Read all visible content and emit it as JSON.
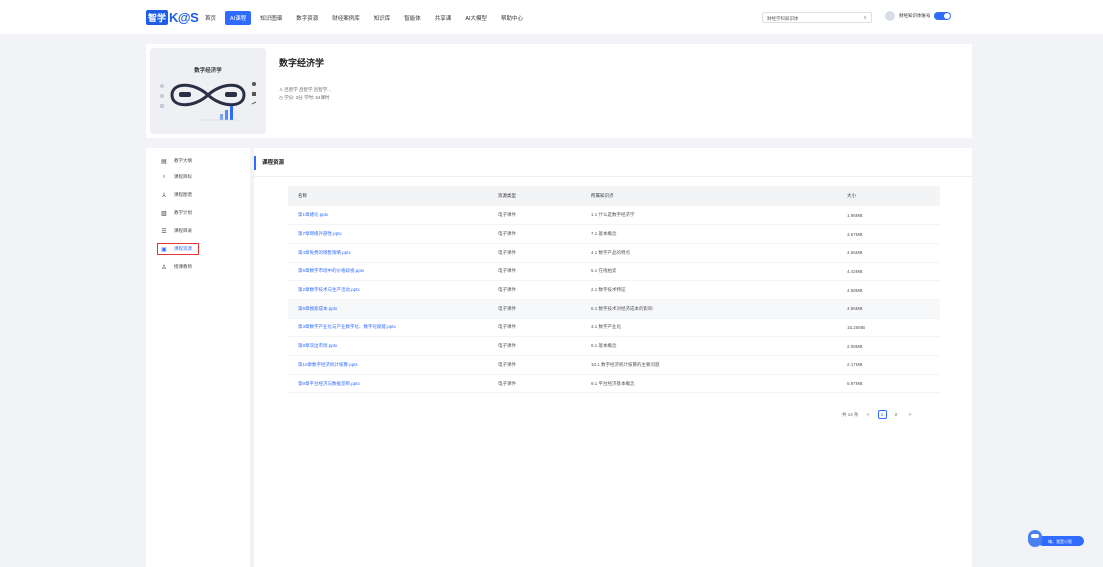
{
  "logo": {
    "part1": "智学",
    "part2": "K@S"
  },
  "nav": [
    {
      "label": "首页"
    },
    {
      "label": "AI课程",
      "active": true
    },
    {
      "label": "知识图谱"
    },
    {
      "label": "数字资源"
    },
    {
      "label": "财经案例库"
    },
    {
      "label": "知识库"
    },
    {
      "label": "智能体"
    },
    {
      "label": "共享课"
    },
    {
      "label": "AI大模型"
    },
    {
      "label": "帮助中心"
    }
  ],
  "header_right": {
    "select_value": "财经学科知识体",
    "user_name": "财经知识体账号"
  },
  "course": {
    "cover_title": "数字经济学",
    "title": "数字经济学",
    "teachers": "吕智学 吕智学 吕智学...",
    "meta": "学分: 3分   学时: 64课时"
  },
  "sidebar": [
    {
      "label": "教学大纲",
      "icon": "book-icon"
    },
    {
      "label": "课程目标",
      "icon": "bulb-icon"
    },
    {
      "label": "课程图谱",
      "icon": "graph-icon"
    },
    {
      "label": "教学计划",
      "icon": "plan-icon"
    },
    {
      "label": "课程目录",
      "icon": "list-icon"
    },
    {
      "label": "课程资源",
      "icon": "resource-icon",
      "active": true
    },
    {
      "label": "授课教师",
      "icon": "user-icon"
    }
  ],
  "main": {
    "section_title": "课程资源",
    "columns": [
      "名称",
      "资源类型",
      "所属知识点",
      "大小"
    ],
    "rows": [
      [
        "第1章绪论.pptx",
        "电子课件",
        "1.1  什么是数字经济学",
        "1.95MB"
      ],
      [
        "第7章网络外部性.pptx",
        "电子课件",
        "7.1  基本概念",
        "3.67MB"
      ],
      [
        "第4章免费的销售策略.pptx",
        "电子课件",
        "4.1  数字产品的特点",
        "3.66MB"
      ],
      [
        "第5章数字市场中的价格歧视.pptx",
        "电子课件",
        "5.1  在线拍卖",
        "4.42MB"
      ],
      [
        "第2章数字技术与生产活动.pptx",
        "电子课件",
        "2.1  数字技术特征",
        "4.58MB"
      ],
      [
        "第6章搜索成本.pptx",
        "电子课件",
        "6.1  数字技术对经济成本的影响",
        "3.96MB"
      ],
      [
        "第3章数字产业化与产业数字化、数字化赋能.pptx",
        "电子课件",
        "3.1  数字产业化",
        "15.25MB"
      ],
      [
        "第8章双边市场.pptx",
        "电子课件",
        "8.1  基本概念",
        "2.08MB"
      ],
      [
        "第10章数字经济统计核算.pptx",
        "电子课件",
        "10.1  数字经济统计核算的主要问题",
        "2.17MB"
      ],
      [
        "第9章平台经济与数据垄断.pptx",
        "电子课件",
        "9.1  平台经济基本概念",
        "5.97MB"
      ]
    ],
    "pager": {
      "total": "共 14 条",
      "prev": "<",
      "pages": [
        "1",
        "2"
      ],
      "next": ">"
    }
  },
  "assistant": {
    "label": "嗨，我是小智"
  }
}
